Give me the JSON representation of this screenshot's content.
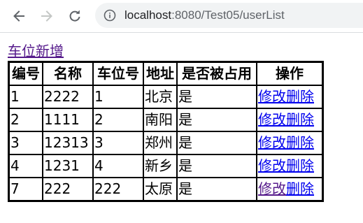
{
  "browser": {
    "url_host": "localhost",
    "url_rest": ":8080/Test05/userList"
  },
  "page": {
    "add_link": "车位新增"
  },
  "table": {
    "headers": [
      "编号",
      "名称",
      "车位号",
      "地址",
      "是否被占用",
      "操作"
    ],
    "rows": [
      {
        "id": "1",
        "name": "2222",
        "spot": "1",
        "address": "北京",
        "occupied": "是",
        "edit": "修改",
        "delete": "删除"
      },
      {
        "id": "2",
        "name": "1111",
        "spot": "2",
        "address": "南阳",
        "occupied": "是",
        "edit": "修改",
        "delete": "删除"
      },
      {
        "id": "3",
        "name": "12313",
        "spot": "3",
        "address": "郑州",
        "occupied": "是",
        "edit": "修改",
        "delete": "删除"
      },
      {
        "id": "4",
        "name": "1231",
        "spot": "4",
        "address": "新乡",
        "occupied": "是",
        "edit": "修改",
        "delete": "删除"
      },
      {
        "id": "7",
        "name": "222",
        "spot": "222",
        "address": "太原",
        "occupied": "是",
        "edit": "修改",
        "delete": "删除"
      }
    ]
  },
  "colors": {
    "link_unvisited": "#0000ee",
    "link_visited": "#551a8b"
  },
  "icons": [
    "back-arrow-icon",
    "forward-arrow-icon",
    "reload-icon",
    "info-icon"
  ]
}
